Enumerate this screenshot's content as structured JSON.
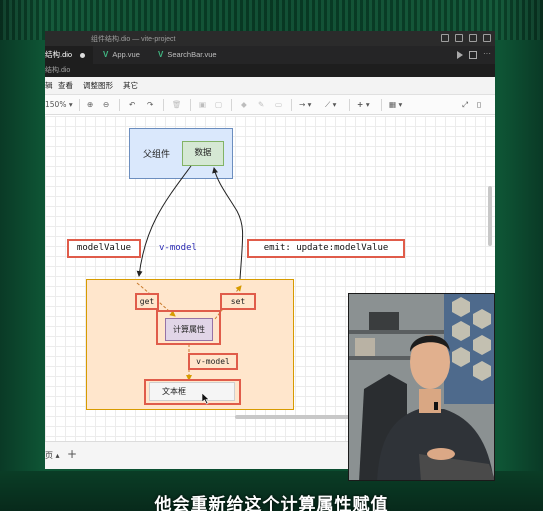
{
  "window": {
    "title": "组件结构.dio — vite-project"
  },
  "tabs": [
    {
      "label": "结构.dio",
      "active": true,
      "modified": true
    },
    {
      "label": "App.vue",
      "active": false
    },
    {
      "label": "SearchBar.vue",
      "active": false
    }
  ],
  "path": "结构.dio",
  "menu": [
    "辑",
    "查看",
    "调整图形",
    "其它"
  ],
  "toolbar": {
    "zoom": "150% ▾",
    "zoom_in": "⊕",
    "zoom_out": "⊖",
    "undo": "↶",
    "redo": "↷",
    "delete": "🗑",
    "fill": "◆",
    "line_color": "✎",
    "shadow": "▭",
    "connector": "→ ▾",
    "waypoint": "⟋ ▾",
    "insert": "+ ▾",
    "table": "▦ ▾",
    "fit": "⤢",
    "format": "▯"
  },
  "diagram": {
    "parent_label": "父组件",
    "data_label": "数据",
    "model_value": "modelValue",
    "v_model_top": "v-model",
    "emit_label": "emit: update:modelValue",
    "get_label": "get",
    "set_label": "set",
    "computed_label": "计算属性",
    "v_model_inner": "v-model",
    "textbox_label": "文本框"
  },
  "statusbar": {
    "page": "页 ▴",
    "add": "+"
  },
  "subtitle": "他会重新给这个计算属性赋值",
  "colors": {
    "parent_fill": "#dae8fc",
    "data_fill": "#d5e8d4",
    "child_fill": "#ffe6cc",
    "computed_fill": "#e1d5e7",
    "highlight": "#e05c4a",
    "vue_green": "#41b883"
  }
}
